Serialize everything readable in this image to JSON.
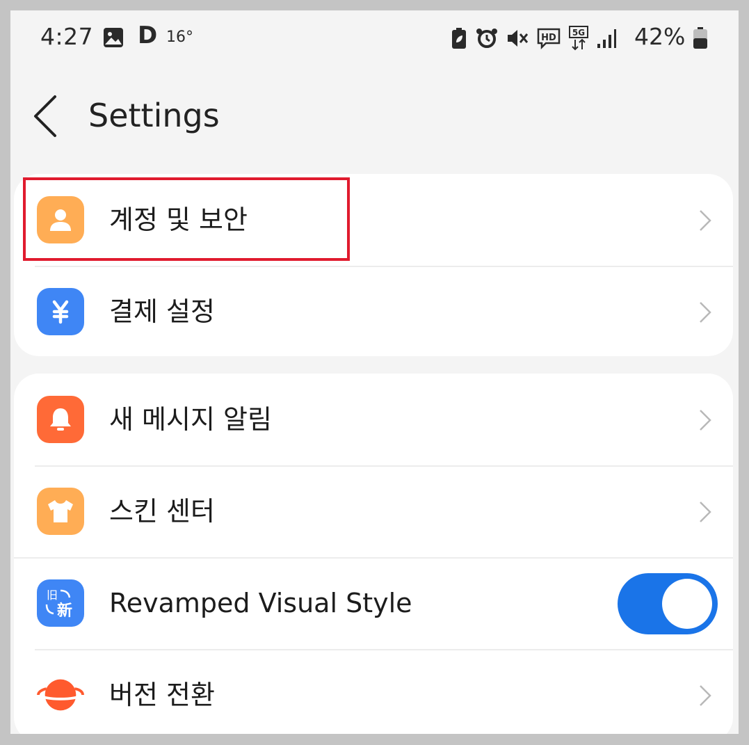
{
  "status_bar": {
    "time": "4:27",
    "notification_letter": "D",
    "temperature": "16°",
    "battery_percent": "42%",
    "icons": [
      "photo-icon",
      "battery-saver-icon",
      "alarm-icon",
      "mute-icon",
      "hd-voice-icon",
      "5g-icon",
      "signal-icon",
      "battery-icon"
    ]
  },
  "header": {
    "title": "Settings"
  },
  "groups": [
    {
      "items": [
        {
          "label": "계정 및 보안",
          "icon": "user-icon",
          "color": "#ffad55",
          "highlighted": true
        },
        {
          "label": "결제 설정",
          "icon": "yen-icon",
          "color": "#3f86f5"
        }
      ]
    },
    {
      "items": [
        {
          "label": "새 메시지 알림",
          "icon": "bell-icon",
          "color": "#ff6a37"
        },
        {
          "label": "스킨 센터",
          "icon": "shirt-icon",
          "color": "#ffad55"
        },
        {
          "label": "Revamped Visual Style",
          "icon": "old-new-icon",
          "color": "#3f86f5",
          "toggle": true,
          "toggle_on": true,
          "icon_text_top": "旧",
          "icon_text_bottom": "新"
        },
        {
          "label": "버전 전환",
          "icon": "planet-icon",
          "color": "#ff5a2e"
        }
      ]
    }
  ],
  "colors": {
    "highlight_border": "#e01b2e",
    "toggle_on": "#1a74e8"
  }
}
